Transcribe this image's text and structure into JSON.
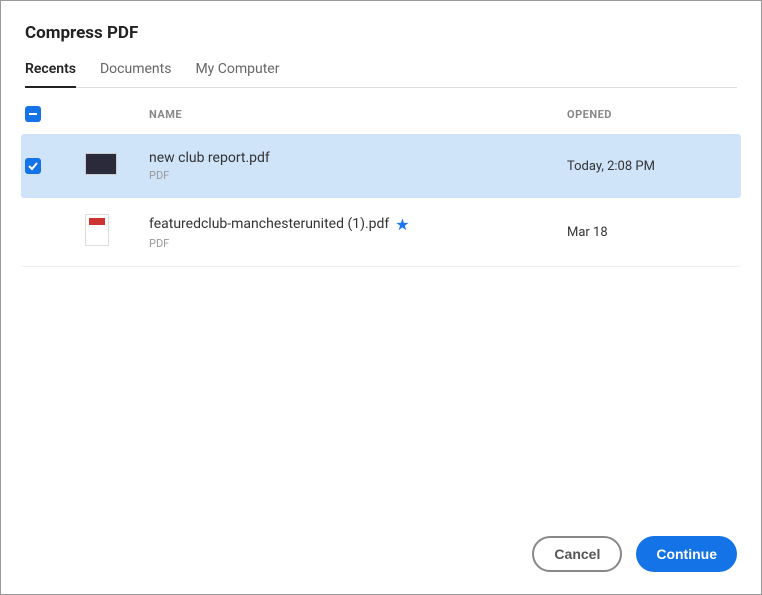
{
  "dialog": {
    "title": "Compress PDF"
  },
  "tabs": [
    {
      "label": "Recents",
      "active": true
    },
    {
      "label": "Documents",
      "active": false
    },
    {
      "label": "My Computer",
      "active": false
    }
  ],
  "columns": {
    "name": "NAME",
    "opened": "OPENED"
  },
  "files": [
    {
      "name": "new club report.pdf",
      "type": "PDF",
      "opened": "Today, 2:08 PM",
      "selected": true,
      "starred": false,
      "thumb": "dark"
    },
    {
      "name": "featuredclub-manchesterunited (1).pdf",
      "type": "PDF",
      "opened": "Mar 18",
      "selected": false,
      "starred": true,
      "thumb": "doc"
    }
  ],
  "footer": {
    "cancel": "Cancel",
    "continue": "Continue"
  }
}
